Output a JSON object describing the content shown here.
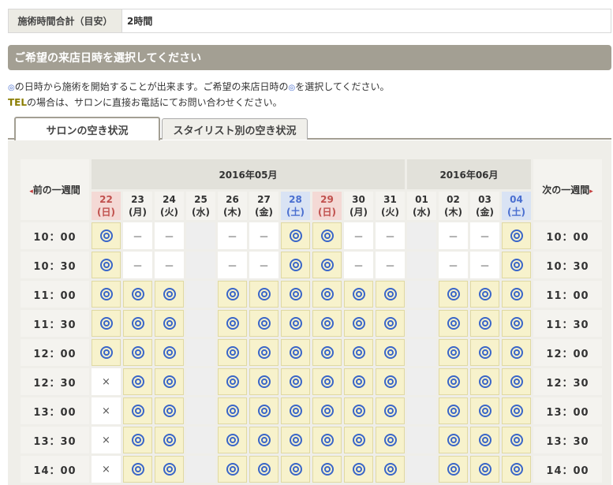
{
  "total": {
    "label": "施術時間合計（目安）",
    "value": "2時間"
  },
  "section_title": "ご希望の来店日時を選択してください",
  "notes": {
    "line1_icon": "◎",
    "line1_a": "の日時から施術を開始することが出来ます。ご希望の来店日時の",
    "line1_icon2": "◎",
    "line1_b": "を選択してください。",
    "line2_tel": "TEL",
    "line2_rest": "の場合は、サロンに直接お電話にてお問い合わせください。"
  },
  "tabs": [
    {
      "label": "サロンの空き状況",
      "active": true
    },
    {
      "label": "スタイリスト別の空き状況",
      "active": false
    }
  ],
  "nav": {
    "prev": "前の一週間",
    "next": "次の一週間",
    "prev_arrow": "◂",
    "next_arrow": "▸"
  },
  "months": [
    {
      "label": "2016年05月",
      "span": 10
    },
    {
      "label": "2016年06月",
      "span": 4
    }
  ],
  "days": [
    {
      "num": "22",
      "wd": "(日)",
      "type": "sun"
    },
    {
      "num": "23",
      "wd": "(月)",
      "type": ""
    },
    {
      "num": "24",
      "wd": "(火)",
      "type": ""
    },
    {
      "num": "25",
      "wd": "(水)",
      "type": ""
    },
    {
      "num": "26",
      "wd": "(木)",
      "type": ""
    },
    {
      "num": "27",
      "wd": "(金)",
      "type": ""
    },
    {
      "num": "28",
      "wd": "(土)",
      "type": "sat"
    },
    {
      "num": "29",
      "wd": "(日)",
      "type": "sun"
    },
    {
      "num": "30",
      "wd": "(月)",
      "type": ""
    },
    {
      "num": "31",
      "wd": "(火)",
      "type": ""
    },
    {
      "num": "01",
      "wd": "(水)",
      "type": ""
    },
    {
      "num": "02",
      "wd": "(木)",
      "type": ""
    },
    {
      "num": "03",
      "wd": "(金)",
      "type": ""
    },
    {
      "num": "04",
      "wd": "(土)",
      "type": "sat"
    }
  ],
  "symbols": {
    "ok": "◎",
    "ng": "×",
    "none": "－"
  },
  "rows": [
    {
      "time": "10：00",
      "slots": [
        "o",
        "-",
        "-",
        "c",
        "-",
        "-",
        "o",
        "o",
        "-",
        "-",
        "c",
        "-",
        "-",
        "o"
      ]
    },
    {
      "time": "10：30",
      "slots": [
        "o",
        "-",
        "-",
        "c",
        "-",
        "-",
        "o",
        "o",
        "-",
        "-",
        "c",
        "-",
        "-",
        "o"
      ]
    },
    {
      "time": "11：00",
      "slots": [
        "o",
        "o",
        "o",
        "c",
        "o",
        "o",
        "o",
        "o",
        "o",
        "o",
        "c",
        "o",
        "o",
        "o"
      ]
    },
    {
      "time": "11：30",
      "slots": [
        "o",
        "o",
        "o",
        "c",
        "o",
        "o",
        "o",
        "o",
        "o",
        "o",
        "c",
        "o",
        "o",
        "o"
      ]
    },
    {
      "time": "12：00",
      "slots": [
        "o",
        "o",
        "o",
        "c",
        "o",
        "o",
        "o",
        "o",
        "o",
        "o",
        "c",
        "o",
        "o",
        "o"
      ]
    },
    {
      "time": "12：30",
      "slots": [
        "x",
        "o",
        "o",
        "c",
        "o",
        "o",
        "o",
        "o",
        "o",
        "o",
        "c",
        "o",
        "o",
        "o"
      ]
    },
    {
      "time": "13：00",
      "slots": [
        "x",
        "o",
        "o",
        "c",
        "o",
        "o",
        "o",
        "o",
        "o",
        "o",
        "c",
        "o",
        "o",
        "o"
      ]
    },
    {
      "time": "13：30",
      "slots": [
        "x",
        "o",
        "o",
        "c",
        "o",
        "o",
        "o",
        "o",
        "o",
        "o",
        "c",
        "o",
        "o",
        "o"
      ]
    },
    {
      "time": "14：00",
      "slots": [
        "x",
        "o",
        "o",
        "c",
        "o",
        "o",
        "o",
        "o",
        "o",
        "o",
        "c",
        "o",
        "o",
        "o"
      ]
    }
  ]
}
